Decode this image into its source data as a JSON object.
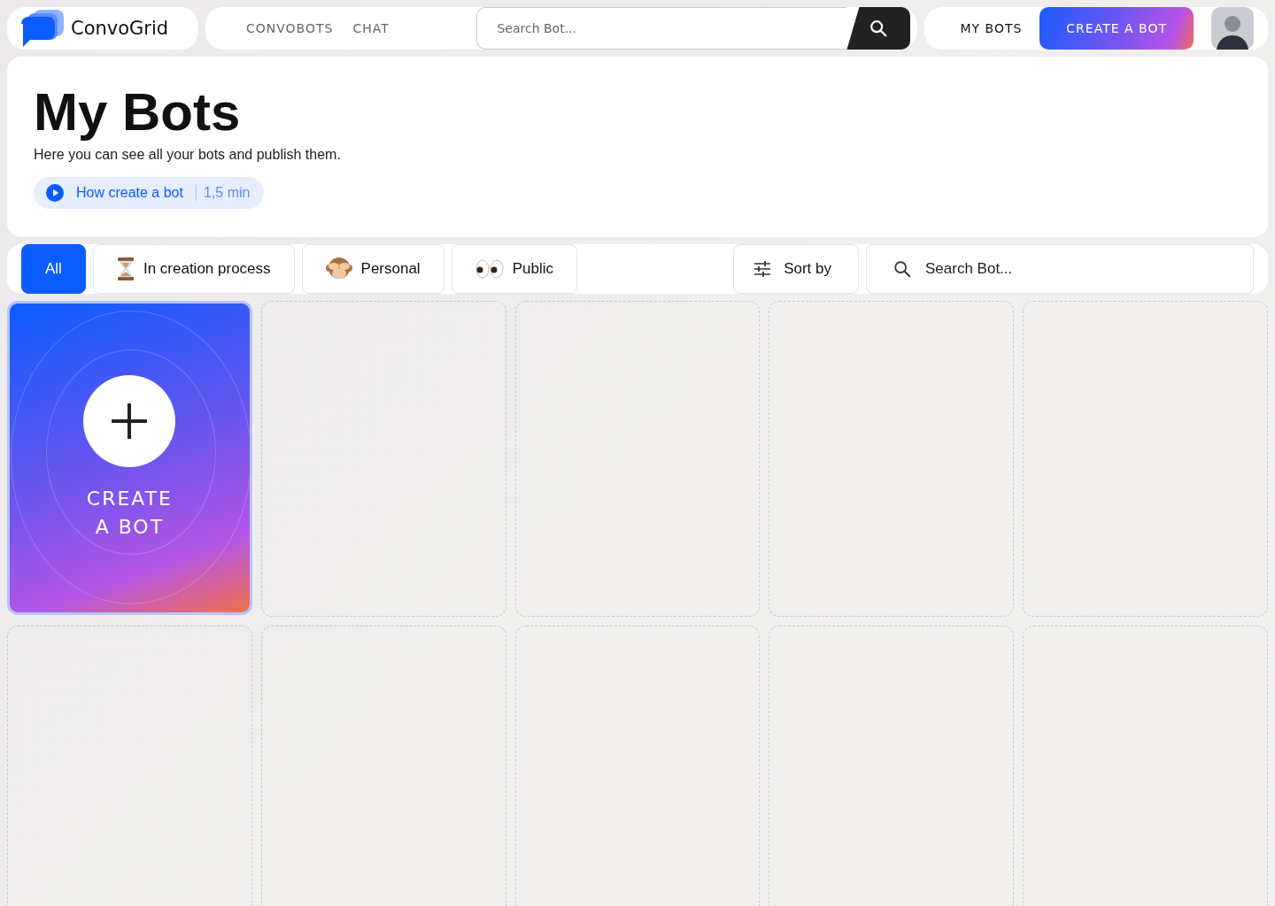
{
  "brand": {
    "name": "ConvoGrid"
  },
  "nav": [
    {
      "label": "CONVOBOTS"
    },
    {
      "label": "CHAT"
    }
  ],
  "top_search": {
    "placeholder": "Search Bot..."
  },
  "my_bots_link": {
    "label": "MY BOTS"
  },
  "create_button": {
    "label": "CREATE A BOT"
  },
  "header": {
    "title": "My Bots",
    "subtitle": "Here you can see all your bots and publish them.",
    "video_link": {
      "label": "How create a bot",
      "duration": "1,5 min"
    }
  },
  "filters": [
    {
      "label": "All",
      "kind": "plain",
      "selected": true
    },
    {
      "label": "In creation process",
      "kind": "hourglass",
      "selected": false
    },
    {
      "label": "Personal",
      "kind": "monkey",
      "selected": false
    },
    {
      "label": "Public",
      "kind": "eyes",
      "selected": false
    }
  ],
  "sort": {
    "label": "Sort by"
  },
  "search": {
    "placeholder": "Search Bot..."
  },
  "slots": [
    {
      "kind": "create",
      "label": "CREATE A BOT"
    },
    {
      "kind": "empty"
    },
    {
      "kind": "empty"
    },
    {
      "kind": "empty"
    },
    {
      "kind": "empty"
    },
    {
      "kind": "empty"
    },
    {
      "kind": "empty"
    },
    {
      "kind": "empty"
    },
    {
      "kind": "empty"
    },
    {
      "kind": "empty"
    }
  ]
}
